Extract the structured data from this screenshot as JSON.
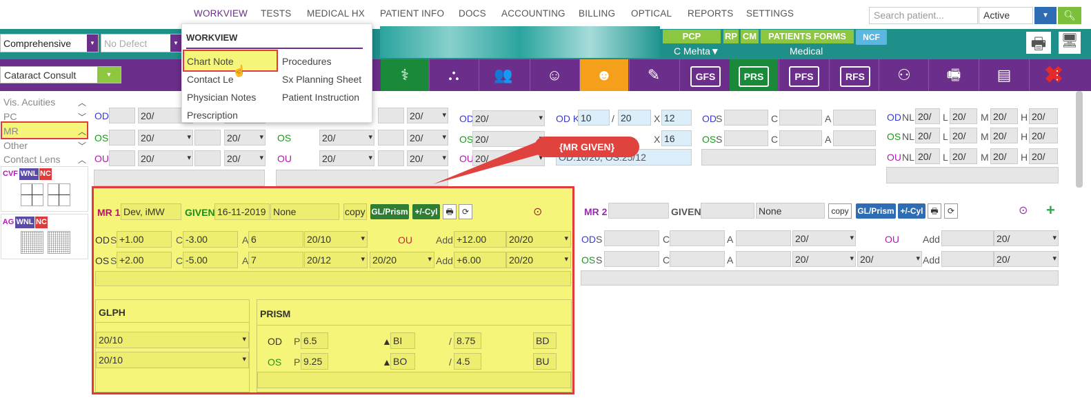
{
  "nav": {
    "tabs": [
      "WORKVIEW",
      "TESTS",
      "MEDICAL HX",
      "PATIENT INFO",
      "DOCS",
      "ACCOUNTING",
      "BILLING",
      "OPTICAL",
      "REPORTS",
      "SETTINGS"
    ],
    "search_placeholder": "Search patient...",
    "status": "Active"
  },
  "header": {
    "exam_type": "Comprehensive",
    "defect": "No Defect",
    "consult": "Cataract Consult",
    "pcp": "PCP",
    "rp": "RP",
    "cm": "CM",
    "forms": "PATIENTS FORMS",
    "ncf": "NCF",
    "doctor": "C Mehta▼",
    "medical": "Medical"
  },
  "icons": {
    "gfs": "GFS",
    "prs": "PRS",
    "pfs": "PFS",
    "rfs": "RFS"
  },
  "dropdown": {
    "heading": "WORKVIEW",
    "items_left": [
      "Chart Note",
      "Contact Le",
      "Physician Notes",
      "Prescription"
    ],
    "items_right": [
      "Procedures",
      "Sx Planning Sheet",
      "Patient Instruction"
    ]
  },
  "sidebar": {
    "items": [
      "Vis. Acuities",
      "PC",
      "MR",
      "Other",
      "Contact Lens"
    ],
    "cvf": "CVF",
    "ag": "AG",
    "wnl": "WNL",
    "nc": "NC"
  },
  "vis": {
    "od": "OD",
    "os": "OS",
    "ou": "OU",
    "v": "20/"
  },
  "k": {
    "k": "K",
    "od1": "10",
    "od2": "20",
    "odx": "12",
    "osx": "16",
    "note": "OD:10/20, OS:25/12",
    "slash": "/",
    "x": "X"
  },
  "sca": {
    "s": "S",
    "c": "C",
    "a": "A"
  },
  "nlmh": {
    "nl": "NL",
    "l": "L",
    "m": "M",
    "h": "H",
    "v": "20/"
  },
  "callout": "{MR GIVEN}",
  "mr1": {
    "title": "MR 1",
    "provider": "Dev, iMW",
    "given": "GIVEN",
    "date": "16-11-2019",
    "none": "None",
    "copy": "copy",
    "glprism": "GL/Prism",
    "cyl": "+/-Cyl",
    "od_s": "+1.00",
    "od_c": "-3.00",
    "od_a": "6",
    "od_va": "20/10",
    "ou": "OU",
    "add": "Add",
    "od_add": "+12.00",
    "od_add_va": "20/20",
    "os_s": "+2.00",
    "os_c": "-5.00",
    "os_a": "7",
    "os_va": "20/12",
    "os_ou_va": "20/20",
    "os_add": "+6.00",
    "os_add_va": "20/20",
    "glph": "GLPH",
    "glph1": "20/10",
    "glph2": "20/10",
    "prism": "PRISM",
    "p": "P",
    "od_p": "6.5",
    "od_bi": "BI",
    "od_p2": "8.75",
    "od_bd": "BD",
    "os_p": "9.25",
    "os_bo": "BO",
    "os_p2": "4.5",
    "os_bu": "BU"
  },
  "mr2": {
    "title": "MR 2",
    "given": "GIVEN",
    "none": "None",
    "copy": "copy",
    "glprism": "GL/Prism",
    "cyl": "+/-Cyl",
    "ou": "OU",
    "add": "Add",
    "v": "20/"
  }
}
